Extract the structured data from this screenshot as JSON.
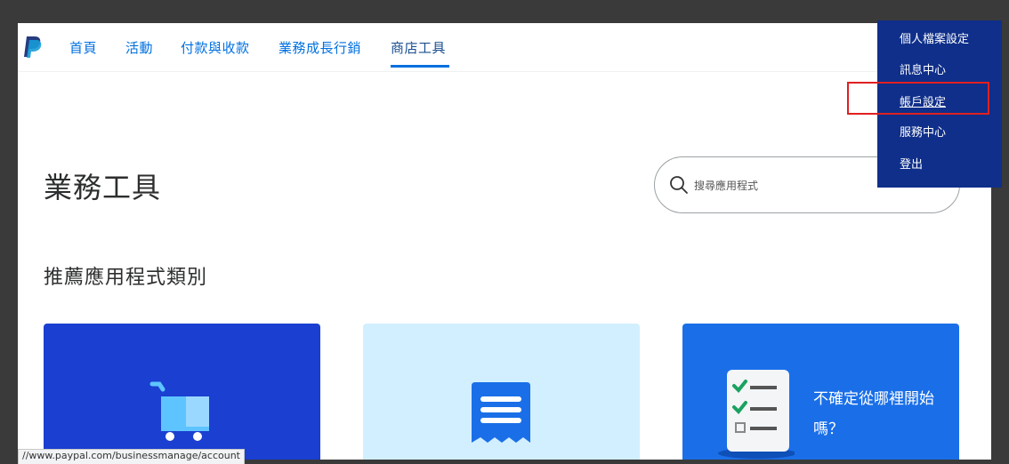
{
  "caption": {
    "left_text": "",
    "center_text": ""
  },
  "nav": {
    "items": [
      {
        "label": "首頁"
      },
      {
        "label": "活動"
      },
      {
        "label": "付款與收款"
      },
      {
        "label": "業務成長行銷"
      },
      {
        "label": "商店工具"
      }
    ],
    "active_index": 4
  },
  "main": {
    "title": "業務工具",
    "search": {
      "placeholder": "搜尋應用程式"
    },
    "section_title": "推薦應用程式類別",
    "cards": [
      {
        "icon": "shopping-cart-icon"
      },
      {
        "icon": "receipt-icon"
      },
      {
        "icon": "checklist-icon",
        "text": "不確定從哪裡開始嗎？"
      }
    ]
  },
  "dropdown": {
    "items": [
      {
        "label": "個人檔案設定"
      },
      {
        "label": "訊息中心"
      },
      {
        "label": "帳戶設定"
      },
      {
        "label": "服務中心"
      },
      {
        "label": "登出"
      }
    ],
    "highlighted_index": 2
  },
  "status_bar": {
    "url": "//www.paypal.com/businessmanage/account"
  },
  "colors": {
    "brand_blue": "#0070e0",
    "dropdown_bg": "#0f2f8a",
    "card_1": "#1a3fd1",
    "card_2": "#d1efff",
    "card_3": "#1a6fe8",
    "highlight": "#e02020"
  }
}
